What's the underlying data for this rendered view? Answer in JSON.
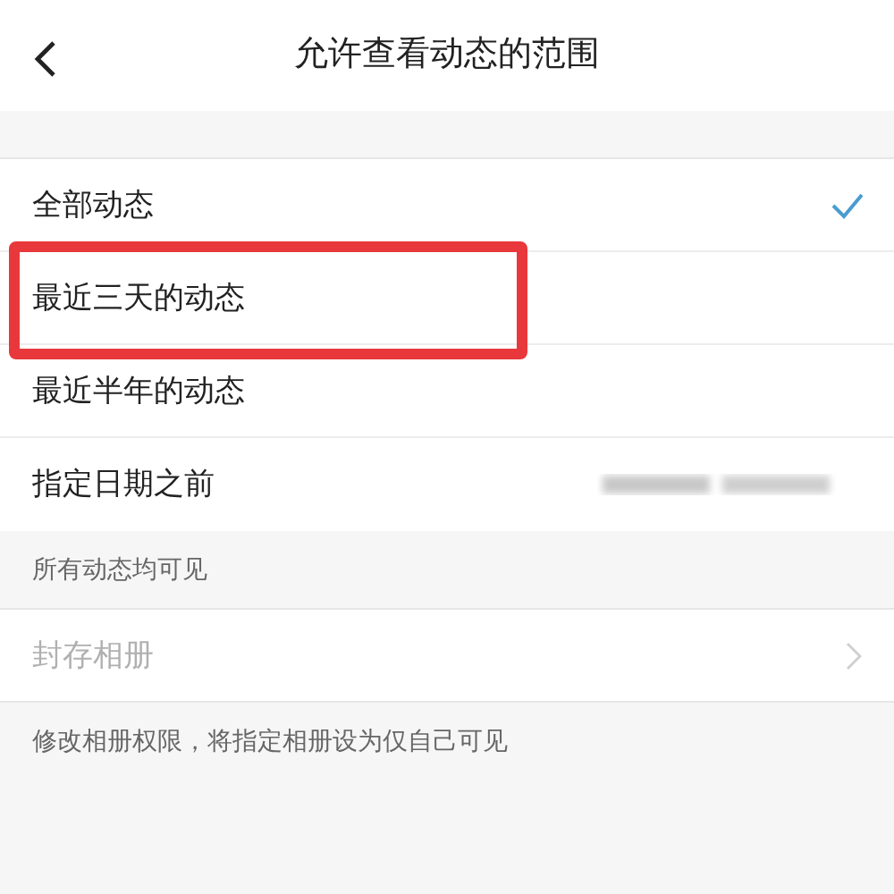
{
  "header": {
    "title": "允许查看动态的范围"
  },
  "options": [
    {
      "kind": "range",
      "label": "全部动态",
      "selected": true,
      "highlighted": false
    },
    {
      "kind": "range",
      "label": "最近三天的动态",
      "selected": false,
      "highlighted": true
    },
    {
      "kind": "range",
      "label": "最近半年的动态",
      "selected": false,
      "highlighted": false
    },
    {
      "kind": "date",
      "label": "指定日期之前",
      "selected": false,
      "highlighted": false
    }
  ],
  "options_note": "所有动态均可见",
  "album": {
    "label": "封存相册",
    "disabled": true
  },
  "album_note": "修改相册权限，将指定相册设为仅自己可见"
}
